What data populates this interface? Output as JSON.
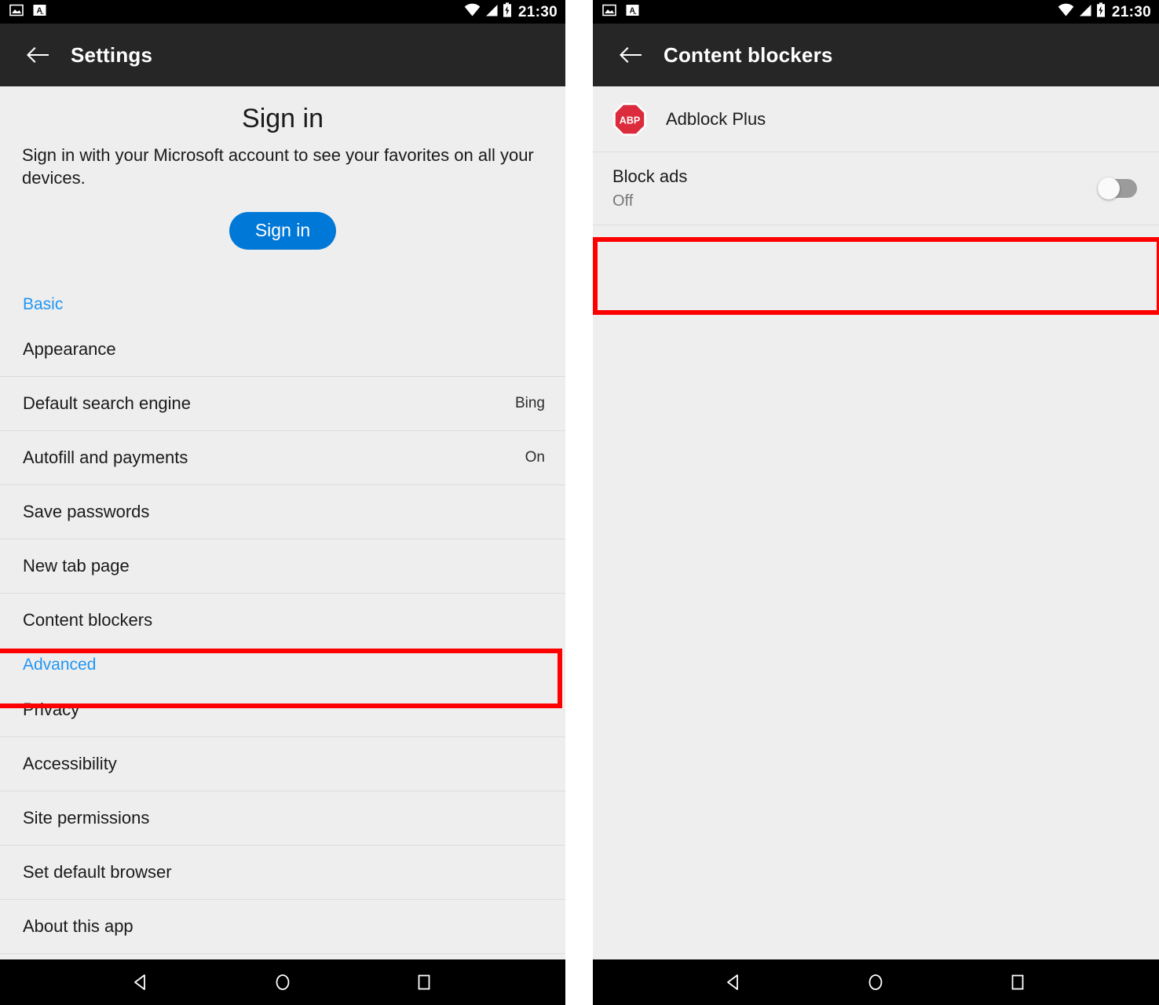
{
  "status_bar": {
    "left_icons": [
      "image-icon",
      "input-method-icon"
    ],
    "right_icons": [
      "wifi-icon",
      "cellular-signal-icon",
      "battery-charging-icon"
    ],
    "clock": "21:30"
  },
  "colors": {
    "toolbar_bg": "#262626",
    "page_bg": "#eeeeee",
    "accent_blue": "#0078d7",
    "section_blue": "#2196f3",
    "highlight_red": "#fe0000",
    "abp_red": "#dc2b3c",
    "divider": "#dcdcdc"
  },
  "left_screen": {
    "toolbar": {
      "back_icon": "back-arrow-icon",
      "title": "Settings"
    },
    "signin": {
      "title": "Sign in",
      "description": "Sign in with your Microsoft account to see your favorites on all your devices.",
      "button_label": "Sign in"
    },
    "sections": [
      {
        "header": "Basic",
        "items": [
          {
            "label": "Appearance",
            "value": ""
          },
          {
            "label": "Default search engine",
            "value": "Bing"
          },
          {
            "label": "Autofill and payments",
            "value": "On"
          },
          {
            "label": "Save passwords",
            "value": ""
          },
          {
            "label": "New tab page",
            "value": ""
          },
          {
            "label": "Content blockers",
            "value": ""
          }
        ]
      },
      {
        "header": "Advanced",
        "items": [
          {
            "label": "Privacy",
            "value": ""
          },
          {
            "label": "Accessibility",
            "value": ""
          },
          {
            "label": "Site permissions",
            "value": ""
          },
          {
            "label": "Set default browser",
            "value": ""
          },
          {
            "label": "About this app",
            "value": ""
          }
        ]
      }
    ],
    "highlight": {
      "target": "Content blockers"
    }
  },
  "right_screen": {
    "toolbar": {
      "back_icon": "back-arrow-icon",
      "title": "Content blockers"
    },
    "extension": {
      "icon": "adblock-plus-icon",
      "icon_text": "ABP",
      "name": "Adblock Plus"
    },
    "setting": {
      "label": "Block ads",
      "state": "Off",
      "toggle_on": false
    },
    "highlight": {
      "target": "Block ads"
    }
  },
  "nav_bar": {
    "back": "nav-back-icon",
    "home": "nav-home-icon",
    "recents": "nav-recents-icon"
  }
}
